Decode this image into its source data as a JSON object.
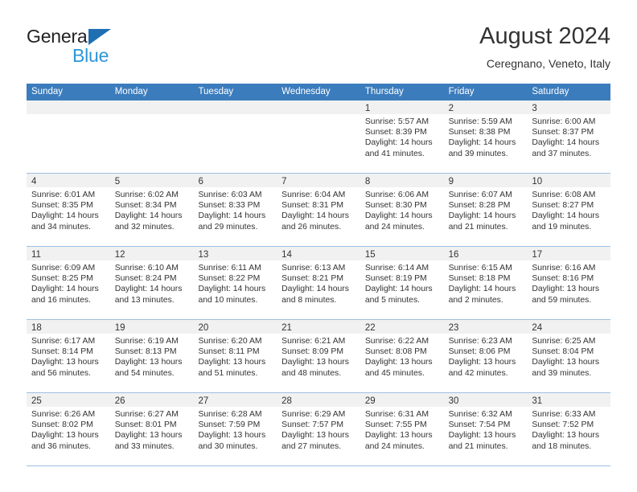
{
  "brand": {
    "name_top": "General",
    "name_bottom": "Blue",
    "triangle_color": "#1f6fb2",
    "blue_text_color": "#2e96d8"
  },
  "header": {
    "title": "August 2024",
    "subtitle": "Ceregnano, Veneto, Italy",
    "header_bg_color": "#3b7cbd",
    "row_divider_color": "#9dc0e0",
    "daynum_band_color": "#f1f1f1"
  },
  "weekdays": [
    "Sunday",
    "Monday",
    "Tuesday",
    "Wednesday",
    "Thursday",
    "Friday",
    "Saturday"
  ],
  "weeks": [
    {
      "days": [
        {
          "num": "",
          "lines": [
            "",
            "",
            "",
            ""
          ]
        },
        {
          "num": "",
          "lines": [
            "",
            "",
            "",
            ""
          ]
        },
        {
          "num": "",
          "lines": [
            "",
            "",
            "",
            ""
          ]
        },
        {
          "num": "",
          "lines": [
            "",
            "",
            "",
            ""
          ]
        },
        {
          "num": "1",
          "lines": [
            "Sunrise: 5:57 AM",
            "Sunset: 8:39 PM",
            "Daylight: 14 hours",
            "and 41 minutes."
          ]
        },
        {
          "num": "2",
          "lines": [
            "Sunrise: 5:59 AM",
            "Sunset: 8:38 PM",
            "Daylight: 14 hours",
            "and 39 minutes."
          ]
        },
        {
          "num": "3",
          "lines": [
            "Sunrise: 6:00 AM",
            "Sunset: 8:37 PM",
            "Daylight: 14 hours",
            "and 37 minutes."
          ]
        }
      ]
    },
    {
      "days": [
        {
          "num": "4",
          "lines": [
            "Sunrise: 6:01 AM",
            "Sunset: 8:35 PM",
            "Daylight: 14 hours",
            "and 34 minutes."
          ]
        },
        {
          "num": "5",
          "lines": [
            "Sunrise: 6:02 AM",
            "Sunset: 8:34 PM",
            "Daylight: 14 hours",
            "and 32 minutes."
          ]
        },
        {
          "num": "6",
          "lines": [
            "Sunrise: 6:03 AM",
            "Sunset: 8:33 PM",
            "Daylight: 14 hours",
            "and 29 minutes."
          ]
        },
        {
          "num": "7",
          "lines": [
            "Sunrise: 6:04 AM",
            "Sunset: 8:31 PM",
            "Daylight: 14 hours",
            "and 26 minutes."
          ]
        },
        {
          "num": "8",
          "lines": [
            "Sunrise: 6:06 AM",
            "Sunset: 8:30 PM",
            "Daylight: 14 hours",
            "and 24 minutes."
          ]
        },
        {
          "num": "9",
          "lines": [
            "Sunrise: 6:07 AM",
            "Sunset: 8:28 PM",
            "Daylight: 14 hours",
            "and 21 minutes."
          ]
        },
        {
          "num": "10",
          "lines": [
            "Sunrise: 6:08 AM",
            "Sunset: 8:27 PM",
            "Daylight: 14 hours",
            "and 19 minutes."
          ]
        }
      ]
    },
    {
      "days": [
        {
          "num": "11",
          "lines": [
            "Sunrise: 6:09 AM",
            "Sunset: 8:25 PM",
            "Daylight: 14 hours",
            "and 16 minutes."
          ]
        },
        {
          "num": "12",
          "lines": [
            "Sunrise: 6:10 AM",
            "Sunset: 8:24 PM",
            "Daylight: 14 hours",
            "and 13 minutes."
          ]
        },
        {
          "num": "13",
          "lines": [
            "Sunrise: 6:11 AM",
            "Sunset: 8:22 PM",
            "Daylight: 14 hours",
            "and 10 minutes."
          ]
        },
        {
          "num": "14",
          "lines": [
            "Sunrise: 6:13 AM",
            "Sunset: 8:21 PM",
            "Daylight: 14 hours",
            "and 8 minutes."
          ]
        },
        {
          "num": "15",
          "lines": [
            "Sunrise: 6:14 AM",
            "Sunset: 8:19 PM",
            "Daylight: 14 hours",
            "and 5 minutes."
          ]
        },
        {
          "num": "16",
          "lines": [
            "Sunrise: 6:15 AM",
            "Sunset: 8:18 PM",
            "Daylight: 14 hours",
            "and 2 minutes."
          ]
        },
        {
          "num": "17",
          "lines": [
            "Sunrise: 6:16 AM",
            "Sunset: 8:16 PM",
            "Daylight: 13 hours",
            "and 59 minutes."
          ]
        }
      ]
    },
    {
      "days": [
        {
          "num": "18",
          "lines": [
            "Sunrise: 6:17 AM",
            "Sunset: 8:14 PM",
            "Daylight: 13 hours",
            "and 56 minutes."
          ]
        },
        {
          "num": "19",
          "lines": [
            "Sunrise: 6:19 AM",
            "Sunset: 8:13 PM",
            "Daylight: 13 hours",
            "and 54 minutes."
          ]
        },
        {
          "num": "20",
          "lines": [
            "Sunrise: 6:20 AM",
            "Sunset: 8:11 PM",
            "Daylight: 13 hours",
            "and 51 minutes."
          ]
        },
        {
          "num": "21",
          "lines": [
            "Sunrise: 6:21 AM",
            "Sunset: 8:09 PM",
            "Daylight: 13 hours",
            "and 48 minutes."
          ]
        },
        {
          "num": "22",
          "lines": [
            "Sunrise: 6:22 AM",
            "Sunset: 8:08 PM",
            "Daylight: 13 hours",
            "and 45 minutes."
          ]
        },
        {
          "num": "23",
          "lines": [
            "Sunrise: 6:23 AM",
            "Sunset: 8:06 PM",
            "Daylight: 13 hours",
            "and 42 minutes."
          ]
        },
        {
          "num": "24",
          "lines": [
            "Sunrise: 6:25 AM",
            "Sunset: 8:04 PM",
            "Daylight: 13 hours",
            "and 39 minutes."
          ]
        }
      ]
    },
    {
      "days": [
        {
          "num": "25",
          "lines": [
            "Sunrise: 6:26 AM",
            "Sunset: 8:02 PM",
            "Daylight: 13 hours",
            "and 36 minutes."
          ]
        },
        {
          "num": "26",
          "lines": [
            "Sunrise: 6:27 AM",
            "Sunset: 8:01 PM",
            "Daylight: 13 hours",
            "and 33 minutes."
          ]
        },
        {
          "num": "27",
          "lines": [
            "Sunrise: 6:28 AM",
            "Sunset: 7:59 PM",
            "Daylight: 13 hours",
            "and 30 minutes."
          ]
        },
        {
          "num": "28",
          "lines": [
            "Sunrise: 6:29 AM",
            "Sunset: 7:57 PM",
            "Daylight: 13 hours",
            "and 27 minutes."
          ]
        },
        {
          "num": "29",
          "lines": [
            "Sunrise: 6:31 AM",
            "Sunset: 7:55 PM",
            "Daylight: 13 hours",
            "and 24 minutes."
          ]
        },
        {
          "num": "30",
          "lines": [
            "Sunrise: 6:32 AM",
            "Sunset: 7:54 PM",
            "Daylight: 13 hours",
            "and 21 minutes."
          ]
        },
        {
          "num": "31",
          "lines": [
            "Sunrise: 6:33 AM",
            "Sunset: 7:52 PM",
            "Daylight: 13 hours",
            "and 18 minutes."
          ]
        }
      ]
    }
  ]
}
